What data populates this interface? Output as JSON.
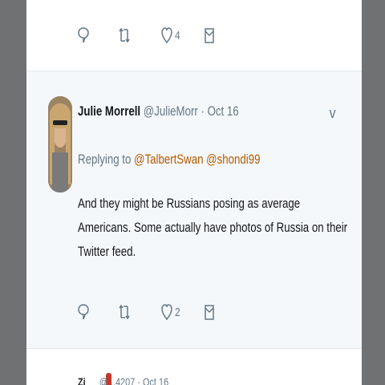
{
  "prev_tweet": {
    "actions": {
      "reply_count": "",
      "retweet_count": "",
      "like_count": "4"
    }
  },
  "tweet": {
    "author_name": "Julie Morrell",
    "handle": "@JulieMorr",
    "separator": " · ",
    "date": "Oct 16",
    "caret": "v",
    "replying_prefix": "Replying to ",
    "mentions": [
      "@TalbertSwan",
      "@shondi99"
    ],
    "text": "And they might be Russians posing as average Americans. Some actually have photos of Russia on their Twitter feed.",
    "actions": {
      "reply_count": "",
      "retweet_count": "",
      "like_count": "2"
    }
  },
  "next_tweet": {
    "peek": "Zi",
    "meta": "@...4207 · Oct 16"
  },
  "colors": {
    "link": "#b35a00",
    "muted": "#657786",
    "text": "#14171a",
    "tweet_bg": "#f5f8fa"
  }
}
